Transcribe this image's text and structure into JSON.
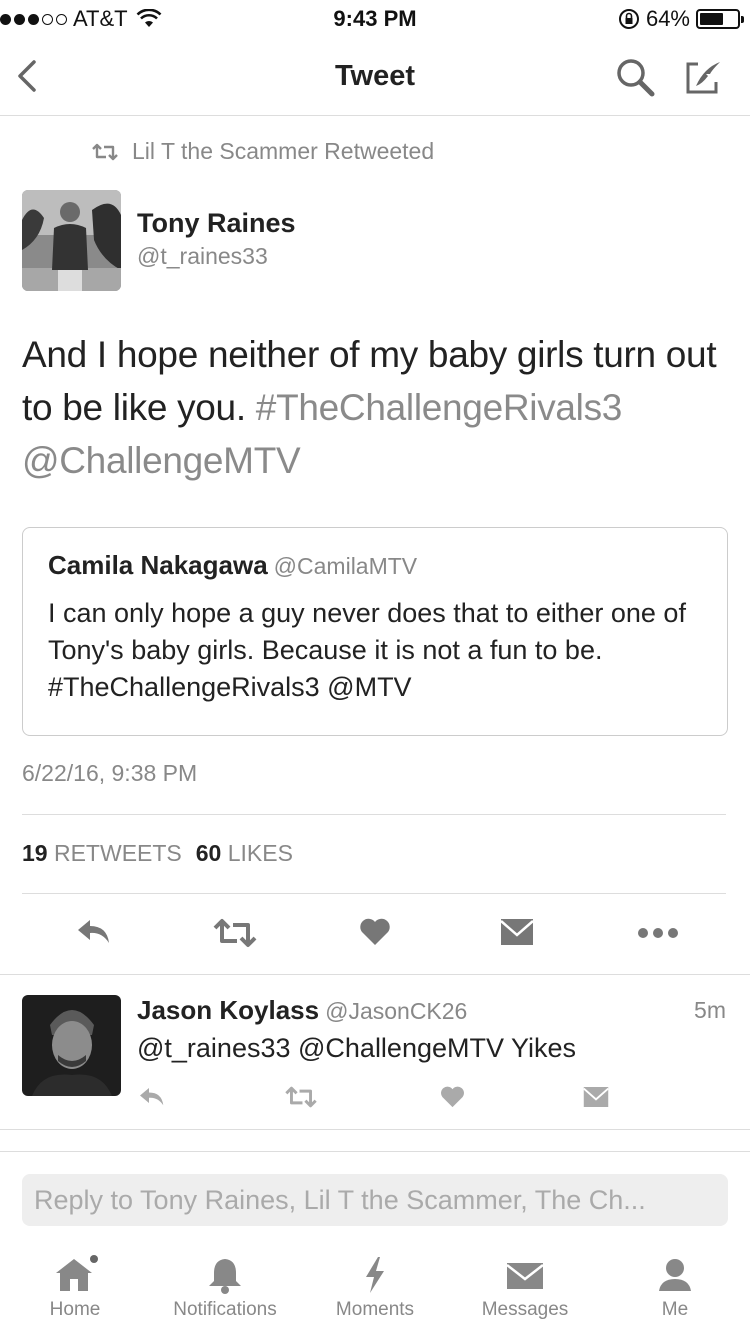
{
  "status_bar": {
    "carrier": "AT&T",
    "time": "9:43 PM",
    "battery_percent": "64%",
    "battery_level": 0.64,
    "signal_dots_filled": 3,
    "signal_dots_total": 5
  },
  "nav": {
    "title": "Tweet",
    "back_icon": "chevron-left-icon",
    "search_icon": "search-icon",
    "compose_icon": "compose-icon"
  },
  "retweeted_by": "Lil T the Scammer Retweeted",
  "tweet": {
    "author_name": "Tony Raines",
    "author_handle": "@t_raines33",
    "text_plain": "And I hope neither of my baby girls turn out to be like you.",
    "text_hashtag": "#TheChallengeRivals3",
    "text_mention": "@ChallengeMTV",
    "quote": {
      "name": "Camila Nakagawa",
      "handle": "@CamilaMTV",
      "text": "I can only hope a guy never does that to either one of Tony's baby girls. Because it is not a fun to be. #TheChallengeRivals3 @MTV"
    },
    "timestamp": "6/22/16, 9:38 PM",
    "retweet_count": "19",
    "retweet_label": "RETWEETS",
    "like_count": "60",
    "like_label": "LIKES"
  },
  "reply": {
    "name": "Jason Koylass",
    "handle": "@JasonCK26",
    "time": "5m",
    "text": "@t_raines33 @ChallengeMTV Yikes"
  },
  "compose": {
    "placeholder": "Reply to Tony Raines, Lil T the Scammer, The Ch..."
  },
  "tabs": [
    {
      "label": "Home",
      "icon": "home-icon"
    },
    {
      "label": "Notifications",
      "icon": "bell-icon"
    },
    {
      "label": "Moments",
      "icon": "lightning-icon"
    },
    {
      "label": "Messages",
      "icon": "envelope-icon"
    },
    {
      "label": "Me",
      "icon": "person-icon"
    }
  ],
  "colors": {
    "text": "#222222",
    "muted": "#888888",
    "icon": "#777777",
    "divider": "#dddddd"
  }
}
